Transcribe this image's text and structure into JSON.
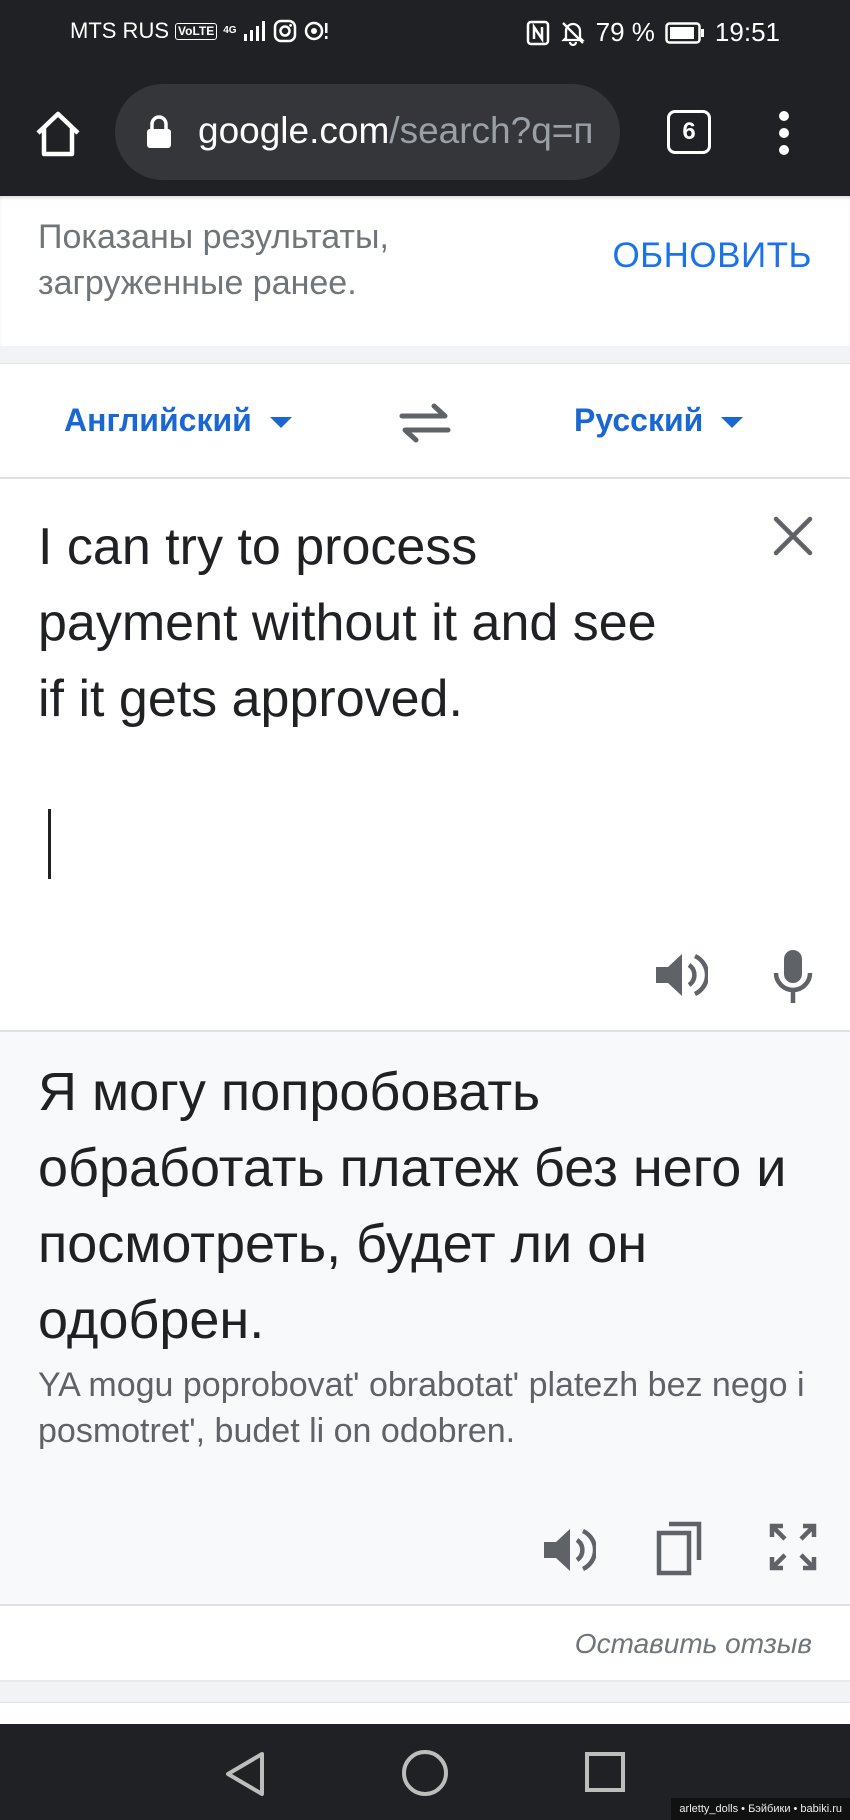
{
  "status_bar": {
    "carrier": "MTS RUS",
    "volte": "VoLTE",
    "network": "4G",
    "battery": "79 %",
    "time": "19:51"
  },
  "browser": {
    "url_host": "google.com",
    "url_path": "/search?q=п",
    "tab_count": "6"
  },
  "notice": {
    "text": "Показаны результаты, загруженные ранее.",
    "action": "ОБНОВИТЬ"
  },
  "translator": {
    "source_lang": "Английский",
    "target_lang": "Русский",
    "source_text": "I can try to process payment without it and see if it gets approved.",
    "translation": "Я могу попробовать обработать платеж без него и посмотреть, будет ли он одобрен.",
    "transliteration": "YA mogu poprobovat' obrabotat' platezh bez nego i posmotret', budet li on odobren.",
    "feedback": "Оставить отзыв"
  },
  "watermark": "arletty_dolls • Бэйбики • babiki.ru",
  "colors": {
    "accent": "#1a73e8",
    "language_link": "#1967d2",
    "chrome_dark": "#202124"
  }
}
